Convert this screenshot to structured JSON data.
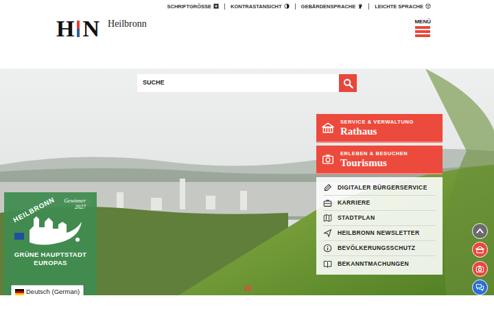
{
  "accessibility_bar": [
    {
      "label": "SCHRIFTGRÖSSE"
    },
    {
      "label": "KONTRASTANSICHT"
    },
    {
      "label": "GEBÄRDENSPRACHE"
    },
    {
      "label": "LEICHTE SPRACHE"
    }
  ],
  "logo": {
    "first_letter": "H",
    "second_letter": "N",
    "city": "Heilbronn"
  },
  "menu": {
    "label": "MENÜ"
  },
  "search": {
    "placeholder": "SUCHE"
  },
  "portals": [
    {
      "kicker": "SERVICE & VERWALTUNG",
      "title": "Rathaus"
    },
    {
      "kicker": "ERLEBEN & BESUCHEN",
      "title": "Tourismus"
    }
  ],
  "quick_links": [
    {
      "label": "DIGITALER BÜRGERSERVICE"
    },
    {
      "label": "KARRIERE"
    },
    {
      "label": "STADTPLAN"
    },
    {
      "label": "HEILBRONN NEWSLETTER"
    },
    {
      "label": "BEVÖLKERUNGSSCHUTZ"
    },
    {
      "label": "BEKANNTMACHUNGEN"
    }
  ],
  "award": {
    "city": "HEILBRONN",
    "winner": "Gewinner",
    "year": "2027",
    "lines": [
      "GRÜNE HAUPTSTADT",
      "EUROPAS"
    ]
  },
  "language": {
    "label": "Deutsch (German)"
  },
  "hero_slider": {
    "playing": true
  }
}
